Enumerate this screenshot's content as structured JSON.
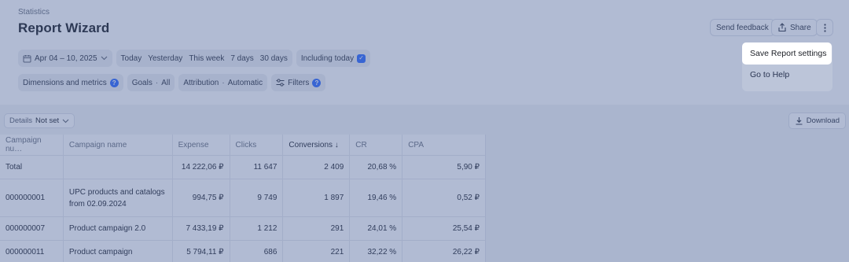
{
  "header": {
    "breadcrumb": "Statistics",
    "title": "Report Wizard",
    "send_feedback": "Send feedback",
    "share": "Share"
  },
  "filters": {
    "date_range": "Apr 04 – 10, 2025",
    "presets": [
      "Today",
      "Yesterday",
      "This week",
      "7 days",
      "30 days"
    ],
    "including_today": "Including today",
    "dimensions": "Dimensions and metrics",
    "goals_label": "Goals",
    "goals_value": "All",
    "attribution_label": "Attribution",
    "attribution_value": "Automatic",
    "filters": "Filters",
    "dimensions_badge": "?",
    "filters_badge": "?"
  },
  "toolbar": {
    "details_label": "Details",
    "details_value": "Not set",
    "download": "Download"
  },
  "table": {
    "columns": [
      "Campaign nu…",
      "Campaign name",
      "Expense",
      "Clicks",
      "Conversions ↓",
      "CR",
      "CPA"
    ],
    "rows": [
      [
        "Total",
        "",
        "14 222,06 ₽",
        "11 647",
        "2 409",
        "20,68 %",
        "5,90 ₽"
      ],
      [
        "000000001",
        "UPC products and catalogs from 02.09.2024",
        "994,75 ₽",
        "9 749",
        "1 897",
        "19,46 %",
        "0,52 ₽"
      ],
      [
        "000000007",
        "Product campaign 2.0",
        "7 433,19 ₽",
        "1 212",
        "291",
        "24,01 %",
        "25,54 ₽"
      ],
      [
        "000000011",
        "Product campaign",
        "5 794,11 ₽",
        "686",
        "221",
        "32,22 %",
        "26,22 ₽"
      ]
    ]
  },
  "menu": {
    "items": [
      "Save Report settings",
      "Go to Help"
    ]
  },
  "colors": {
    "accent": "#2f6bff",
    "overlay": "#455c96"
  }
}
